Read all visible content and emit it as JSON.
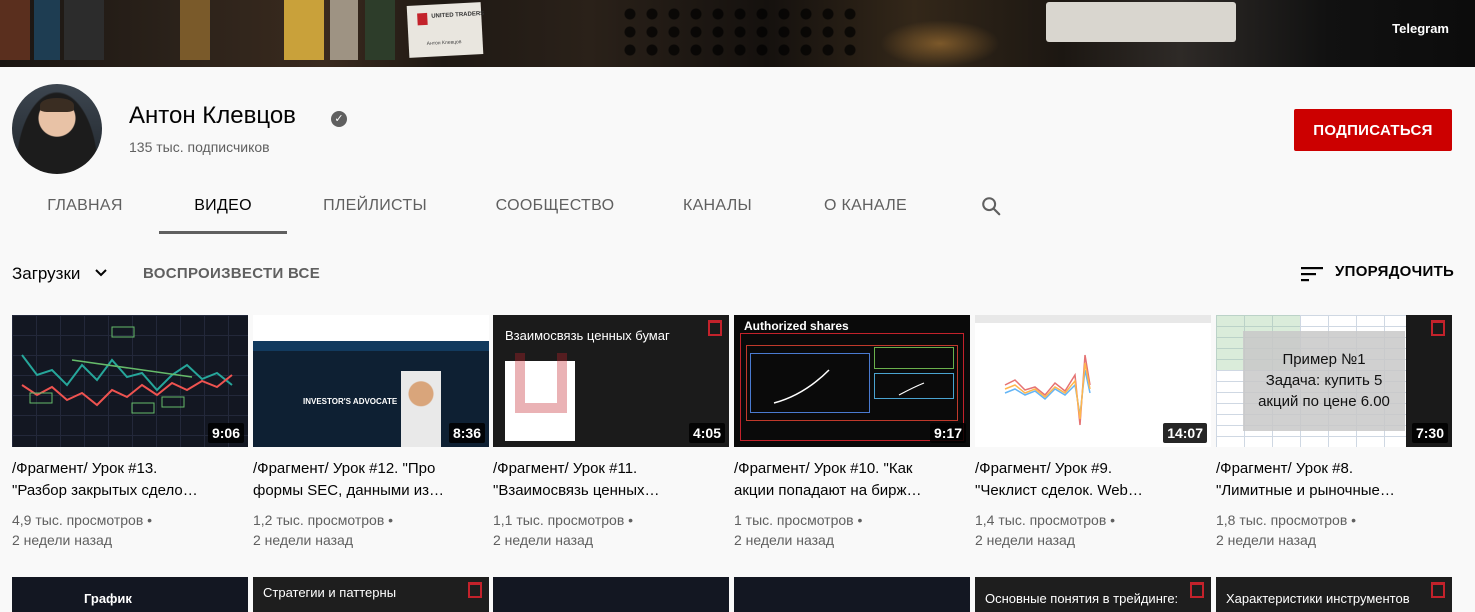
{
  "banner": {
    "link_label": "Telegram",
    "card_title": "UNITED TRADERS",
    "card_name": "Антон Клевцов"
  },
  "channel": {
    "name": "Антон Клевцов",
    "subscribers": "135 тыс. подписчиков",
    "subscribe_label": "ПОДПИСАТЬСЯ"
  },
  "tabs": [
    "ГЛАВНАЯ",
    "ВИДЕО",
    "ПЛЕЙЛИСТЫ",
    "СООБЩЕСТВО",
    "КАНАЛЫ",
    "О КАНАЛЕ"
  ],
  "active_tab": "ВИДЕО",
  "toolbar": {
    "uploads_label": "Загрузки",
    "play_all": "ВОСПРОИЗВЕСТИ ВСЕ",
    "sort_label": "УПОРЯДОЧИТЬ"
  },
  "videos": [
    {
      "title_line1": "/Фрагмент/ Урок #13.",
      "title_line2": "\"Разбор закрытых сдело…",
      "duration": "9:06",
      "views": "4,9 тыс. просмотров",
      "age": "2 недели назад"
    },
    {
      "title_line1": "/Фрагмент/ Урок #12. \"Про",
      "title_line2": "формы SEC, данными из…",
      "duration": "8:36",
      "views": "1,2 тыс. просмотров",
      "age": "2 недели назад"
    },
    {
      "title_line1": "/Фрагмент/ Урок #11.",
      "title_line2": "\"Взаимосвязь ценных…",
      "duration": "4:05",
      "views": "1,1 тыс. просмотров",
      "age": "2 недели назад",
      "thumb_text": "Взаимосвязь ценных бумаг"
    },
    {
      "title_line1": "/Фрагмент/ Урок #10. \"Как",
      "title_line2": "акции попадают на бирж…",
      "duration": "9:17",
      "views": "1 тыс. просмотров",
      "age": "2 недели назад",
      "thumb_text": "Authorized shares"
    },
    {
      "title_line1": "/Фрагмент/ Урок #9.",
      "title_line2": "\"Чеклист сделок. Web…",
      "duration": "14:07",
      "views": "1,4 тыс. просмотров",
      "age": "2 недели назад"
    },
    {
      "title_line1": "/Фрагмент/ Урок #8.",
      "title_line2": "\"Лимитные и рыночные…",
      "duration": "7:30",
      "views": "1,8 тыс. просмотров",
      "age": "2 недели назад",
      "thumb_box": {
        "line1": "Пример №1",
        "line2": "Задача: купить 5",
        "line3": "акций по цене 6.00"
      }
    }
  ],
  "row2_labels": [
    "График",
    "Стратегии и паттерны",
    "",
    "",
    "Основные понятия в трейдинге:",
    "Характеристики инструментов"
  ],
  "colors": {
    "accent_red": "#cc0000",
    "text_secondary": "#606060"
  }
}
